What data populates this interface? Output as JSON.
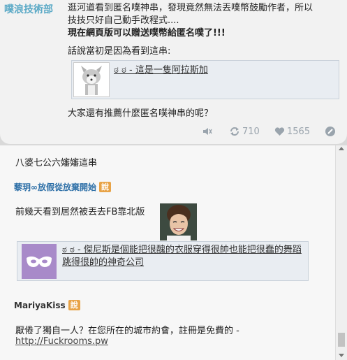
{
  "post": {
    "author": "噗浪技術部",
    "line1": "逛河道看到匿名噗神串，發現竟然無法丟噗幣鼓勵作者，所以",
    "line2": "技技只好自己動手改程式....",
    "line3": "現在網頁版可以贈送噗幣給匿名噗了!!!",
    "line4": "話說當初是因為看到這串:",
    "embed_text": "ಠ ಠ - 這是一隻阿拉斯加",
    "question": "大家還有推薦什麼匿名噗神串的呢？",
    "replurks": "710",
    "likes": "1565"
  },
  "responses": {
    "r1_text": "八婆七公六嬸嬸這串",
    "user1": "藜玥∞放假從放棄開始",
    "says_label": "說",
    "r2_text": "前幾天看到居然被丟去FB靠北版",
    "embed2_text": "ಠ ಠ - 傑尼斯是個能把很醜的衣服穿得很帥也能把很蠢的舞蹈跳得很帥的神奇公司",
    "user2": "MariyaKiss",
    "r3_text": "厭倦了獨自一人？在您所在的城市約會，註冊是免費的 -",
    "r3_link": "http://Fuckrooms.pw"
  },
  "colors": {
    "author": "#5aa9c6",
    "says_badge": "#e8a347",
    "user1": "#2d6fa7",
    "icon": "#9aa4ad"
  }
}
